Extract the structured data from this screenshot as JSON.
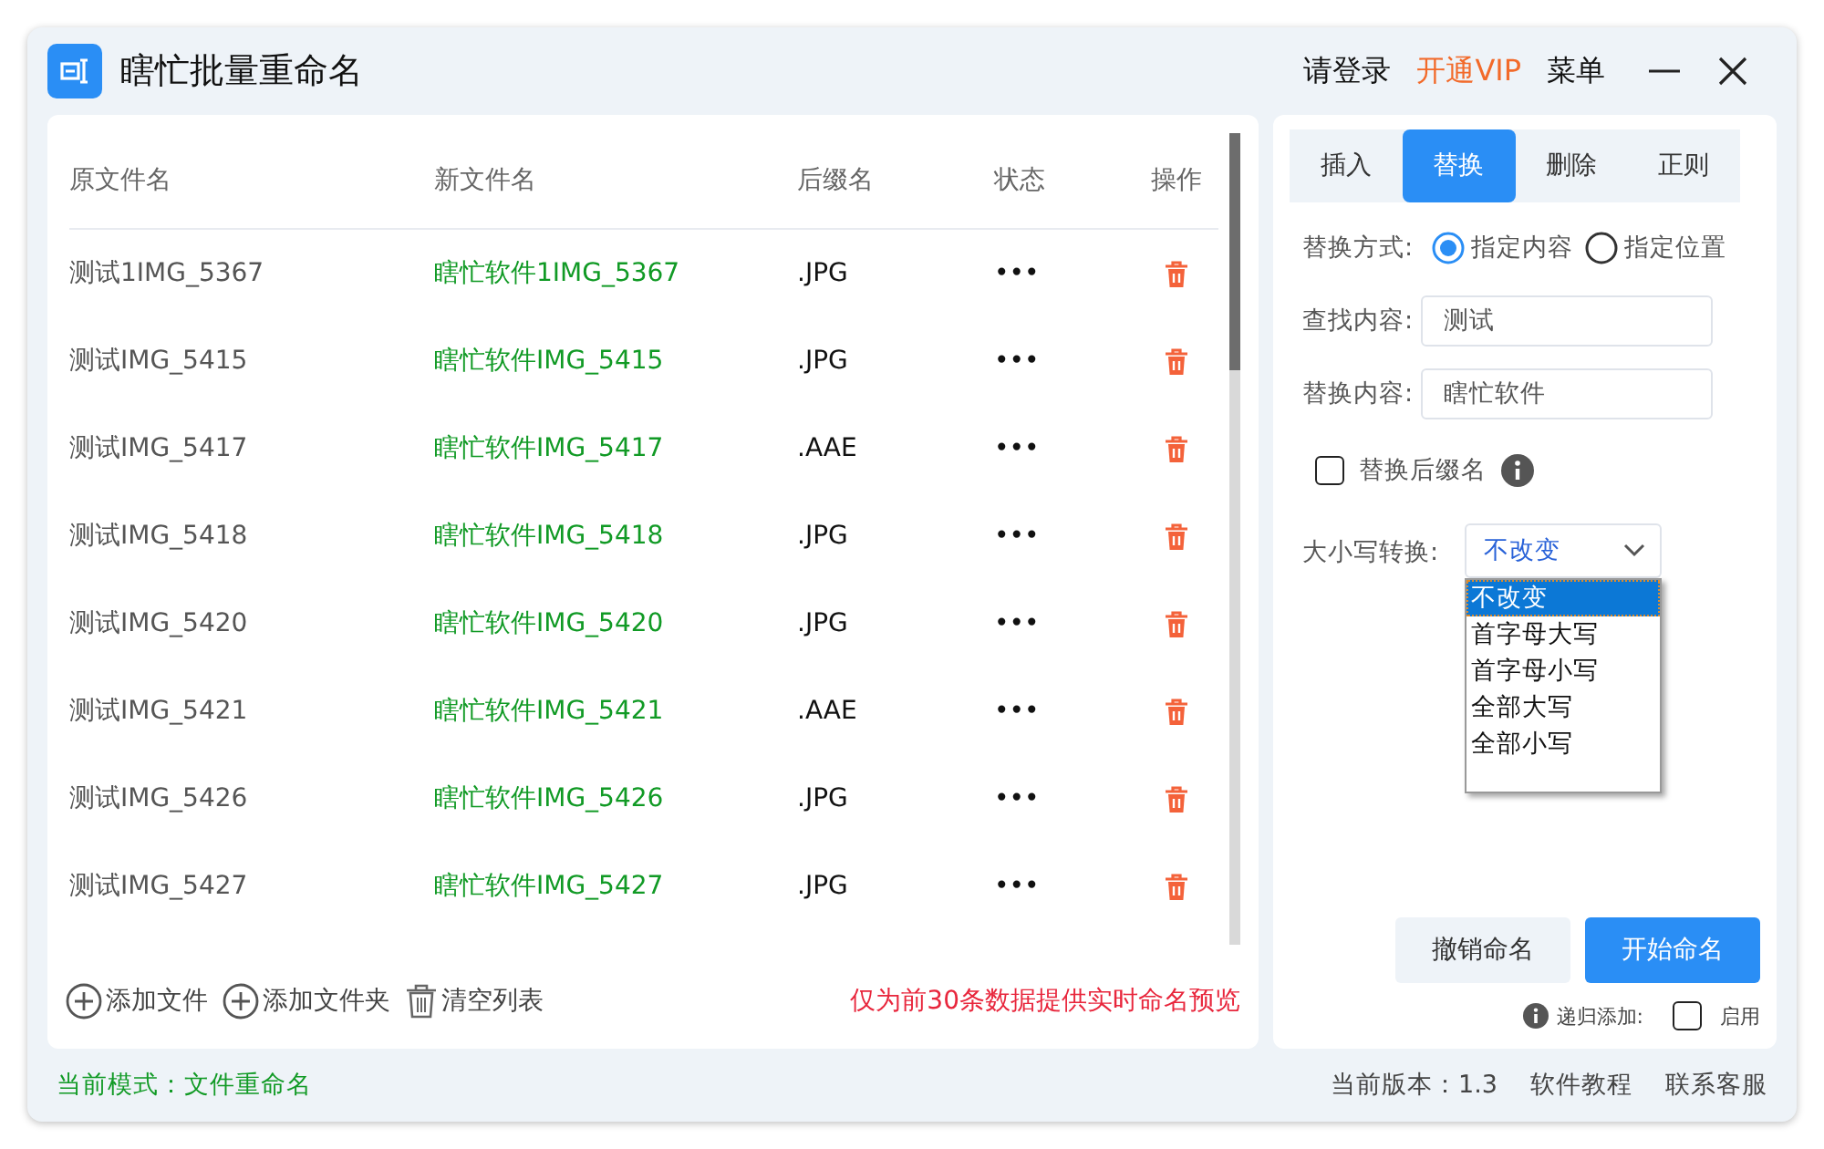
{
  "window": {
    "title": "瞎忙批量重命名",
    "actions": [
      {
        "label": "请登录",
        "kind": "plain"
      },
      {
        "label": "开通VIP",
        "kind": "vip"
      },
      {
        "label": "菜单",
        "kind": "plain"
      }
    ]
  },
  "table": {
    "columns": [
      "原文件名",
      "新文件名",
      "后缀名",
      "状态",
      "操作"
    ],
    "rows": [
      {
        "original": "测试1IMG_5367",
        "new": "瞎忙软件1IMG_5367",
        "ext": ".JPG",
        "status": "•••"
      },
      {
        "original": "测试IMG_5415",
        "new": "瞎忙软件IMG_5415",
        "ext": ".JPG",
        "status": "•••"
      },
      {
        "original": "测试IMG_5417",
        "new": "瞎忙软件IMG_5417",
        "ext": ".AAE",
        "status": "•••"
      },
      {
        "original": "测试IMG_5418",
        "new": "瞎忙软件IMG_5418",
        "ext": ".JPG",
        "status": "•••"
      },
      {
        "original": "测试IMG_5420",
        "new": "瞎忙软件IMG_5420",
        "ext": ".JPG",
        "status": "•••"
      },
      {
        "original": "测试IMG_5421",
        "new": "瞎忙软件IMG_5421",
        "ext": ".AAE",
        "status": "•••"
      },
      {
        "original": "测试IMG_5426",
        "new": "瞎忙软件IMG_5426",
        "ext": ".JPG",
        "status": "•••"
      },
      {
        "original": "测试IMG_5427",
        "new": "瞎忙软件IMG_5427",
        "ext": ".JPG",
        "status": "•••"
      }
    ]
  },
  "toolbar": [
    {
      "label": "添加文件",
      "kind": "add"
    },
    {
      "label": "添加文件夹",
      "kind": "add"
    },
    {
      "label": "清空列表",
      "kind": "trash"
    }
  ],
  "preview_note": "仅为前30条数据提供实时命名预览",
  "tabs": [
    {
      "label": "插入",
      "selected": false
    },
    {
      "label": "替换",
      "selected": true
    },
    {
      "label": "删除",
      "selected": false
    },
    {
      "label": "正则",
      "selected": false
    }
  ],
  "replace_mode": {
    "label": "替换方式:",
    "options": [
      {
        "label": "指定内容",
        "selected": true
      },
      {
        "label": "指定位置",
        "selected": false
      }
    ]
  },
  "find": {
    "label": "查找内容:",
    "value": "测试"
  },
  "replace": {
    "label": "替换内容:",
    "value": "瞎忙软件"
  },
  "replace_ext": {
    "label": "替换后缀名",
    "checked": false
  },
  "case": {
    "label": "大小写转换:",
    "value": "不改变",
    "options": [
      {
        "label": "不改变",
        "selected": true
      },
      {
        "label": "首字母大写",
        "selected": false
      },
      {
        "label": "首字母小写",
        "selected": false
      },
      {
        "label": "全部大写",
        "selected": false
      },
      {
        "label": "全部小写",
        "selected": false
      }
    ]
  },
  "buttons": [
    {
      "label": "撤销命名",
      "kind": "secondary"
    },
    {
      "label": "开始命名",
      "kind": "primary"
    }
  ],
  "recursive": {
    "label": "递归添加:",
    "option": "启用",
    "checked": false
  },
  "status_bar": {
    "mode": "当前模式：文件重命名",
    "version": "当前版本：1.3",
    "links": [
      "软件教程",
      "联系客服"
    ]
  }
}
